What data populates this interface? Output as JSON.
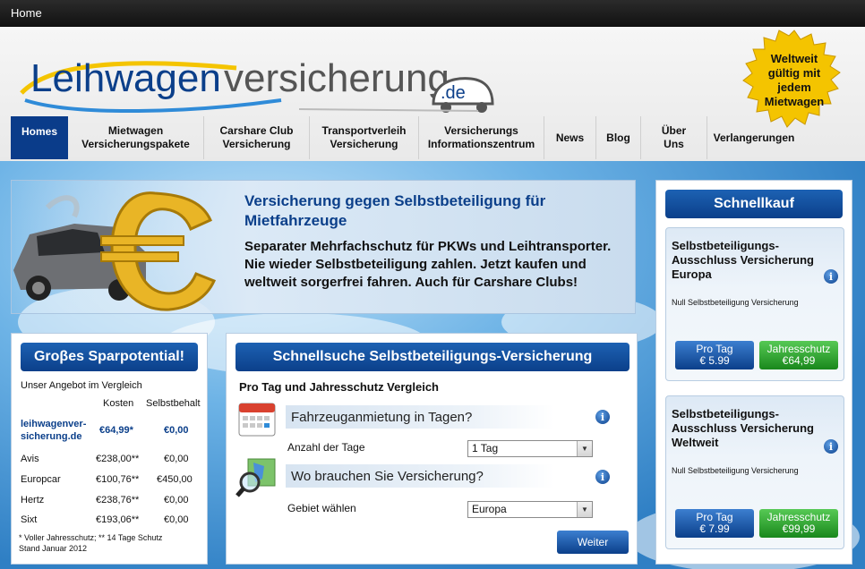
{
  "topbar": {
    "home": "Home"
  },
  "header": {
    "logo_text": "Leihwagenversicherung.de",
    "badge_lines": [
      "Weltweit",
      "gültig mit",
      "jedem",
      "Mietwagen"
    ]
  },
  "nav": {
    "items": [
      {
        "label": "Homes"
      },
      {
        "label": "Mietwagen\nVersicherungspakete"
      },
      {
        "label": "Carshare Club\nVersicherung"
      },
      {
        "label": "Transportverleih\nVersicherung"
      },
      {
        "label": "Versicherungs\nInformationszentrum"
      },
      {
        "label": "News"
      },
      {
        "label": "Blog"
      },
      {
        "label": "Über Uns"
      },
      {
        "label": "Verlangerungen"
      }
    ]
  },
  "hero": {
    "title": "Versicherung gegen Selbstbeteiligung für Mietfahrzeuge",
    "text": "Separater Mehrfachschutz für PKWs und Leihtransporter. Nie wieder Selbstbeteiligung zahlen. Jetzt kaufen und weltweit sorgerfrei fahren. Auch für Carshare Clubs!"
  },
  "spar": {
    "title": "Groβes Sparpotential!",
    "intro": "Unser Angebot im Vergleich",
    "col_cost": "Kosten",
    "col_excess": "Selbstbehalt",
    "rows": [
      {
        "name": "leihwagenver-\nsicherung.de",
        "cost": "€64,99*",
        "excess": "€0,00"
      },
      {
        "name": "Avis",
        "cost": "€238,00**",
        "excess": "€0,00"
      },
      {
        "name": "Europcar",
        "cost": "€100,76**",
        "excess": "€450,00"
      },
      {
        "name": "Hertz",
        "cost": "€238,76**",
        "excess": "€0,00"
      },
      {
        "name": "Sixt",
        "cost": "€193,06**",
        "excess": "€0,00"
      }
    ],
    "footnote": "* Voller Jahresschutz; ** 14 Tage Schutz\nStand Januar 2012"
  },
  "search": {
    "title": "Schnellsuche Selbstbeteiligungs-Versicherung",
    "subtitle": "Pro Tag und Jahresschutz Vergleich",
    "q1": "Fahrzeuganmietung in Tagen?",
    "q1_label": "Anzahl der Tage",
    "q1_value": "1 Tag",
    "q2": "Wo brauchen Sie Versicherung?",
    "q2_label": "Gebiet wählen",
    "q2_value": "Europa",
    "button": "Weiter"
  },
  "quickbuy": {
    "title": "Schnellkauf",
    "offers": [
      {
        "title": "Selbstbeteiligungs-Ausschluss Versicherung Europa",
        "sub": "Null Selbstbeteiligung Versicherung",
        "day_label": "Pro Tag",
        "day_price": "€ 5.99",
        "year_label": "Jahresschutz",
        "year_price": "€64,99"
      },
      {
        "title": "Selbstbeteiligungs-Ausschluss Versicherung Weltweit",
        "sub": "Null Selbstbeteiligung Versicherung",
        "day_label": "Pro Tag",
        "day_price": "€ 7.99",
        "year_label": "Jahresschutz",
        "year_price": "€99,99"
      }
    ]
  },
  "colors": {
    "brand_blue": "#0b3f8a",
    "green": "#19881c",
    "badge_yellow": "#f4c400"
  }
}
